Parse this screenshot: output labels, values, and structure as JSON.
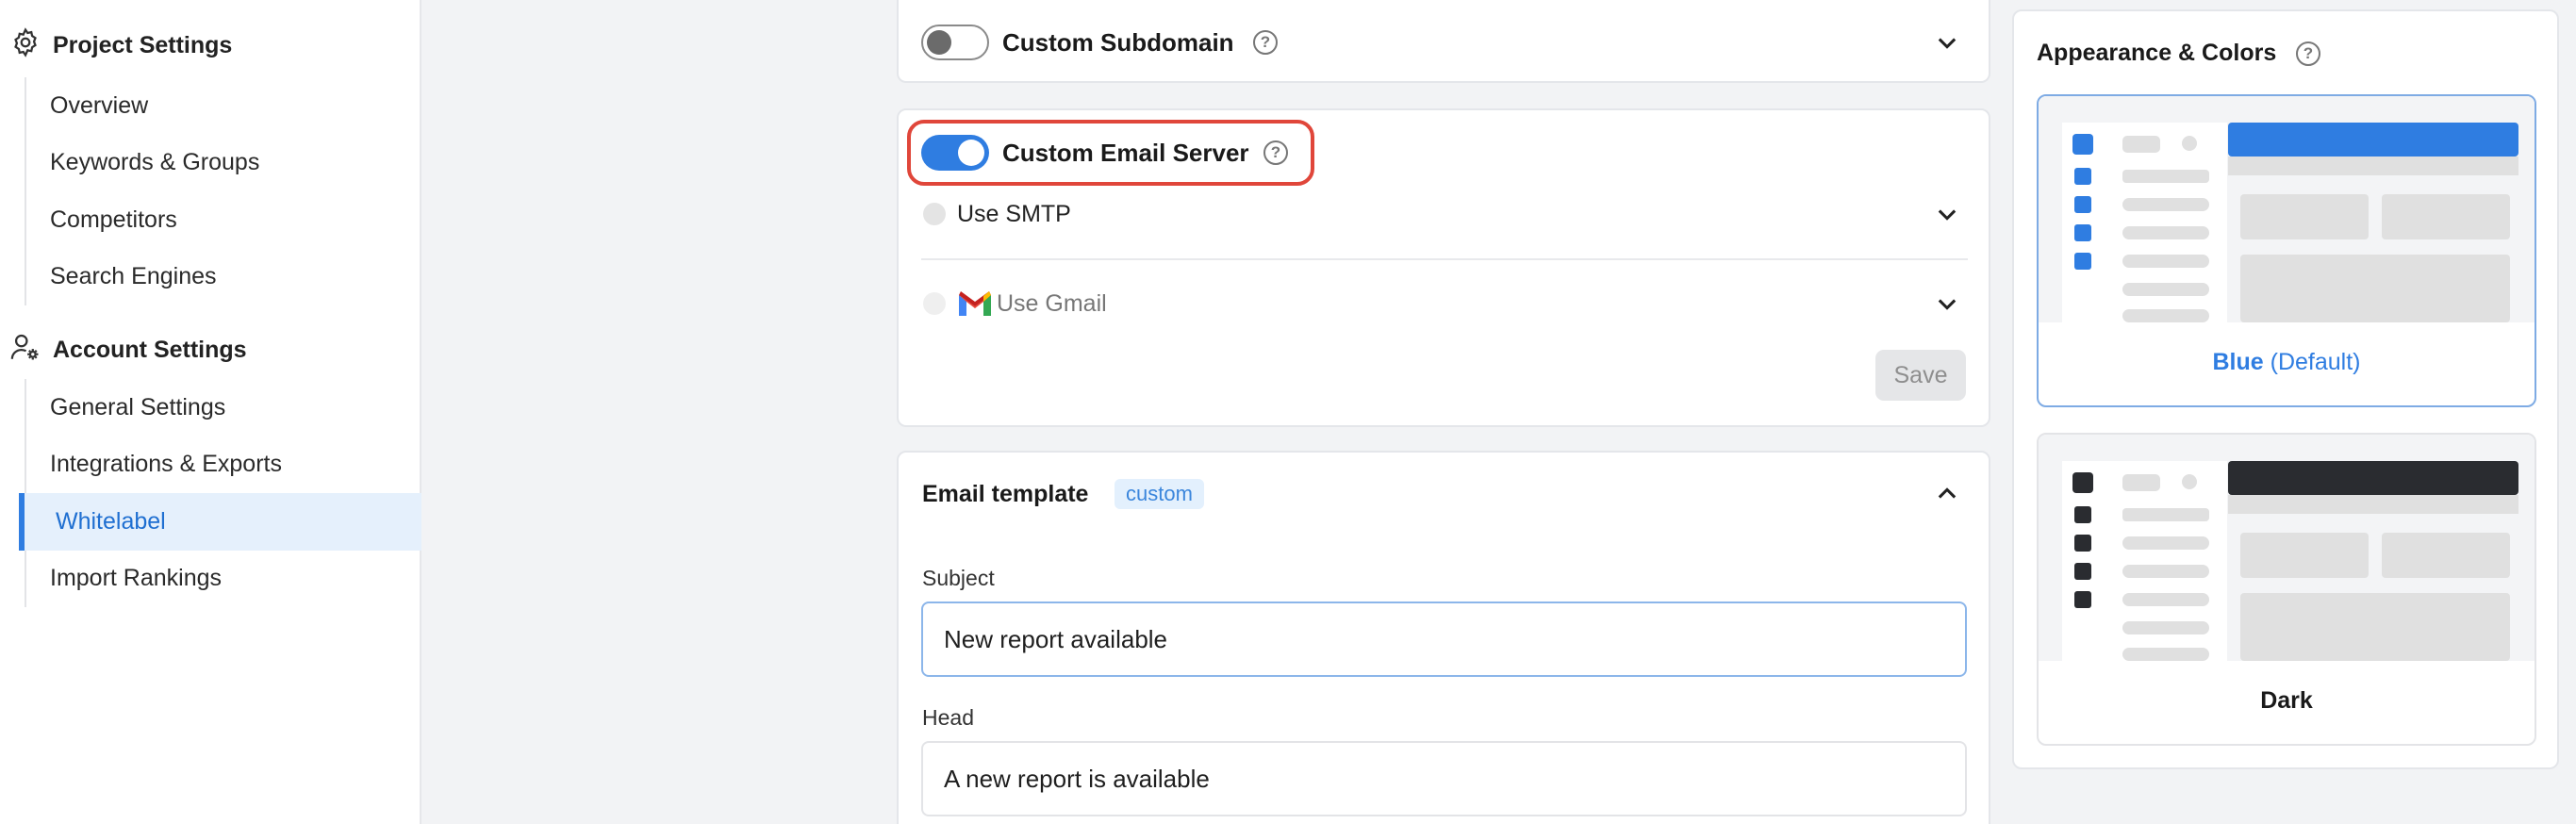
{
  "sidebar": {
    "project_settings": {
      "title": "Project Settings",
      "items": [
        "Overview",
        "Keywords & Groups",
        "Competitors",
        "Search Engines"
      ]
    },
    "account_settings": {
      "title": "Account Settings",
      "items": [
        "General Settings",
        "Integrations & Exports",
        "Whitelabel",
        "Import Rankings"
      ],
      "active": "Whitelabel"
    }
  },
  "custom_subdomain": {
    "title": "Custom Subdomain",
    "enabled": false
  },
  "custom_email_server": {
    "title": "Custom Email Server",
    "enabled": true,
    "options": [
      "Use SMTP",
      "Use Gmail"
    ],
    "save_label": "Save"
  },
  "email_template": {
    "title": "Email template",
    "badge": "custom",
    "subject_label": "Subject",
    "subject_value": "New report available",
    "head_label": "Head",
    "head_value": "A new report is available"
  },
  "appearance": {
    "title": "Appearance & Colors",
    "themes": [
      {
        "name": "Blue",
        "suffix": "(Default)",
        "selected": true,
        "accent": "#2f7de1"
      },
      {
        "name": "Dark",
        "suffix": "",
        "selected": false,
        "accent": "#2a2c30"
      }
    ]
  },
  "colors": {
    "accent": "#2f7de1",
    "highlight": "#e0463a",
    "gmail_red": "#ea4335"
  }
}
